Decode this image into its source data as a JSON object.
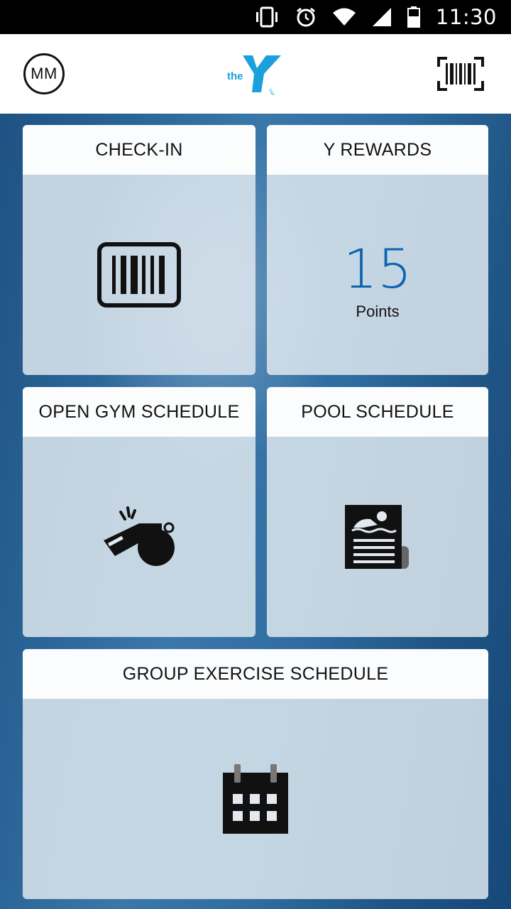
{
  "status_bar": {
    "time": "11:30",
    "icons": [
      "vibrate-icon",
      "alarm-icon",
      "wifi-icon",
      "signal-icon",
      "battery-icon"
    ]
  },
  "header": {
    "avatar_initials": "MM",
    "logo_text": "the",
    "logo_subtext": "YMCA",
    "brand_color": "#1aa0dc"
  },
  "cards": {
    "checkin": {
      "title": "CHECK-IN",
      "icon": "barcode-icon"
    },
    "rewards": {
      "title": "Y REWARDS",
      "points_value": "15",
      "points_label": "Points",
      "accent_color": "#0c63b0"
    },
    "open_gym": {
      "title": "OPEN GYM SCHEDULE",
      "icon": "whistle-icon"
    },
    "pool": {
      "title": "POOL SCHEDULE",
      "icon": "swim-schedule-icon"
    },
    "group_exercise": {
      "title": "GROUP EXERCISE SCHEDULE",
      "icon": "calendar-icon"
    }
  }
}
